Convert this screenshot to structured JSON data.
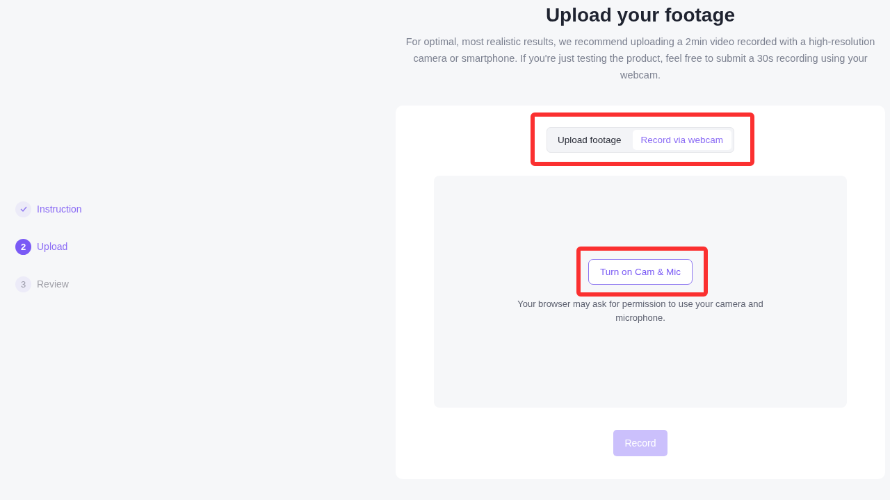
{
  "steps": [
    {
      "label": "Instruction",
      "completed": true,
      "selected": false
    },
    {
      "number": "2",
      "label": "Upload",
      "completed": false,
      "selected": true
    },
    {
      "number": "3",
      "label": "Review",
      "completed": false,
      "selected": false
    }
  ],
  "title": "Upload your footage",
  "description": "For optimal, most realistic results, we recommend uploading a 2min video recorded with a high-resolution camera or smartphone. If you're just testing the product, feel free to submit a 30s recording using your webcam.",
  "tabs_highlighted": true,
  "tabs": [
    {
      "label": "Upload footage",
      "selected": false
    },
    {
      "label": "Record via webcam",
      "selected": true
    }
  ],
  "camera_button": {
    "label": "Turn on Cam & Mic",
    "highlighted": true
  },
  "permission_note": "Your browser may ask for permission to use your camera and microphone.",
  "record_button": {
    "label": "Record",
    "disabled": true
  }
}
